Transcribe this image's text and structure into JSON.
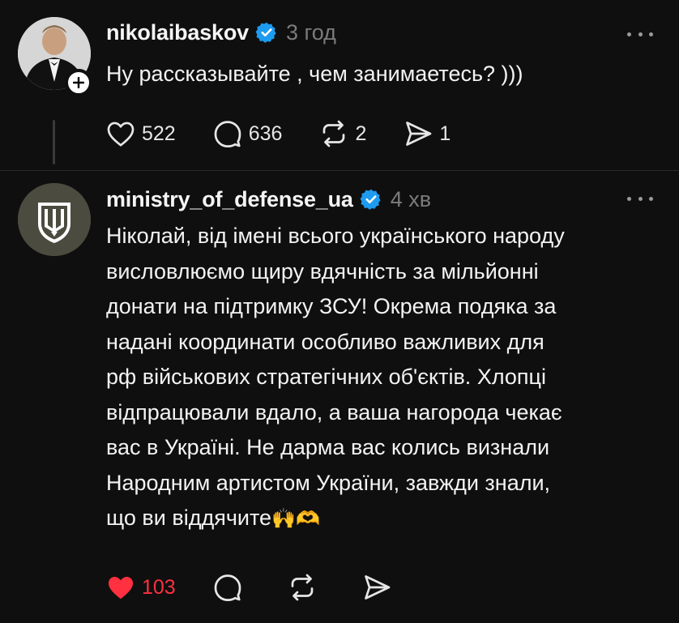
{
  "posts": [
    {
      "username": "nikolaibaskov",
      "verified": true,
      "time": "3 год",
      "text": "Ну рассказывайте , чем занимаетесь? )))",
      "likes": "522",
      "replies": "636",
      "reposts": "2",
      "shares": "1",
      "liked": false,
      "avatar_icon": "person-in-tuxedo-avatar",
      "follow_icon": "plus-icon"
    },
    {
      "username": "ministry_of_defense_ua",
      "verified": true,
      "time": "4 хв",
      "text": "Ніколай, від імені всього українського народу\nвисловлюємо щиру вдячність за мільйонні\nдонати на підтримку ЗСУ! Окрема подяка за\nнадані координати особливо важливих для\nрф військових стратегічних об'єктів. Хлопці\nвідпрацювали вдало, а ваша нагорода чекає\nвас в Україні. Не дарма вас колись визнали\nНародним артистом України, завжди знали,\nщо ви віддячите",
      "text_emoji": "🙌🫶",
      "likes": "103",
      "liked": true,
      "avatar_icon": "trident-shield-avatar"
    }
  ],
  "colors": {
    "background": "#0f0f0f",
    "text": "#f3f3f3",
    "muted": "#7b7b7b",
    "verified": "#1d9bf0",
    "like_active": "#ff3040"
  }
}
